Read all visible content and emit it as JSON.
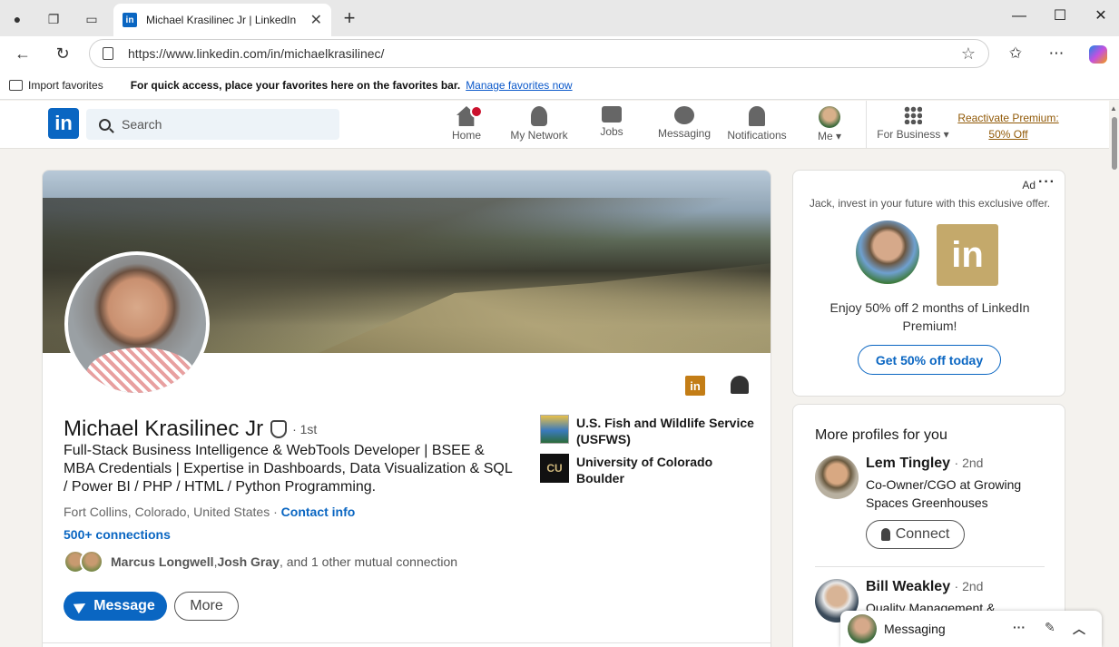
{
  "browser": {
    "tab_title": "Michael Krasilinec Jr | LinkedIn",
    "tab_favicon": "in",
    "url": "https://www.linkedin.com/in/michaelkrasilinec/",
    "favbar": {
      "import_label": "Import favorites",
      "message": "For quick access, place your favorites here on the favorites bar.",
      "link": "Manage favorites now"
    }
  },
  "header": {
    "logo": "in",
    "search_placeholder": "Search",
    "nav": [
      {
        "label": "Home",
        "icon": "home-icon",
        "notification": true
      },
      {
        "label": "My Network",
        "icon": "people-icon"
      },
      {
        "label": "Jobs",
        "icon": "briefcase-icon"
      },
      {
        "label": "Messaging",
        "icon": "chat-icon"
      },
      {
        "label": "Notifications",
        "icon": "bell-icon"
      },
      {
        "label": "Me",
        "icon": "avatar-icon"
      }
    ],
    "business_label": "For Business",
    "premium_link": "Reactivate Premium: 50% Off"
  },
  "profile": {
    "name": "Michael Krasilinec Jr",
    "degree": "· 1st",
    "headline": "Full-Stack Business Intelligence & WebTools Developer | BSEE & MBA Credentials | Expertise in Dashboards, Data Visualization & SQL / Power BI / PHP / HTML / Python Programming.",
    "location": "Fort Collins, Colorado, United States",
    "location_sep": " · ",
    "contact_info": "Contact info",
    "connections": "500+ connections",
    "mutual_a": "Marcus Longwell",
    "mutual_sep": ", ",
    "mutual_b": "Josh Gray",
    "mutual_rest": ", and 1 other mutual connection",
    "message_button": "Message",
    "more_button": "More",
    "orgs": [
      {
        "name": "U.S. Fish and Wildlife Service (USFWS)"
      },
      {
        "name": "University of Colorado Boulder",
        "logo_text": "CU"
      }
    ]
  },
  "ad": {
    "label": "Ad",
    "tagline": "Jack, invest in your future with this exclusive offer.",
    "logo_text": "in",
    "body": "Enjoy 50% off 2 months of LinkedIn Premium!",
    "cta": "Get 50% off today"
  },
  "more_profiles": {
    "title": "More profiles for you",
    "people": [
      {
        "name": "Lem Tingley",
        "degree": "· 2nd",
        "role": "Co-Owner/CGO at Growing Spaces Greenhouses",
        "action": "Connect"
      },
      {
        "name": "Bill Weakley",
        "degree": "· 2nd",
        "role": "Quality Management &"
      }
    ]
  },
  "messaging": {
    "label": "Messaging"
  },
  "colors": {
    "brand": "#0a66c2",
    "premium": "#915907",
    "badge": "#cb112d"
  }
}
